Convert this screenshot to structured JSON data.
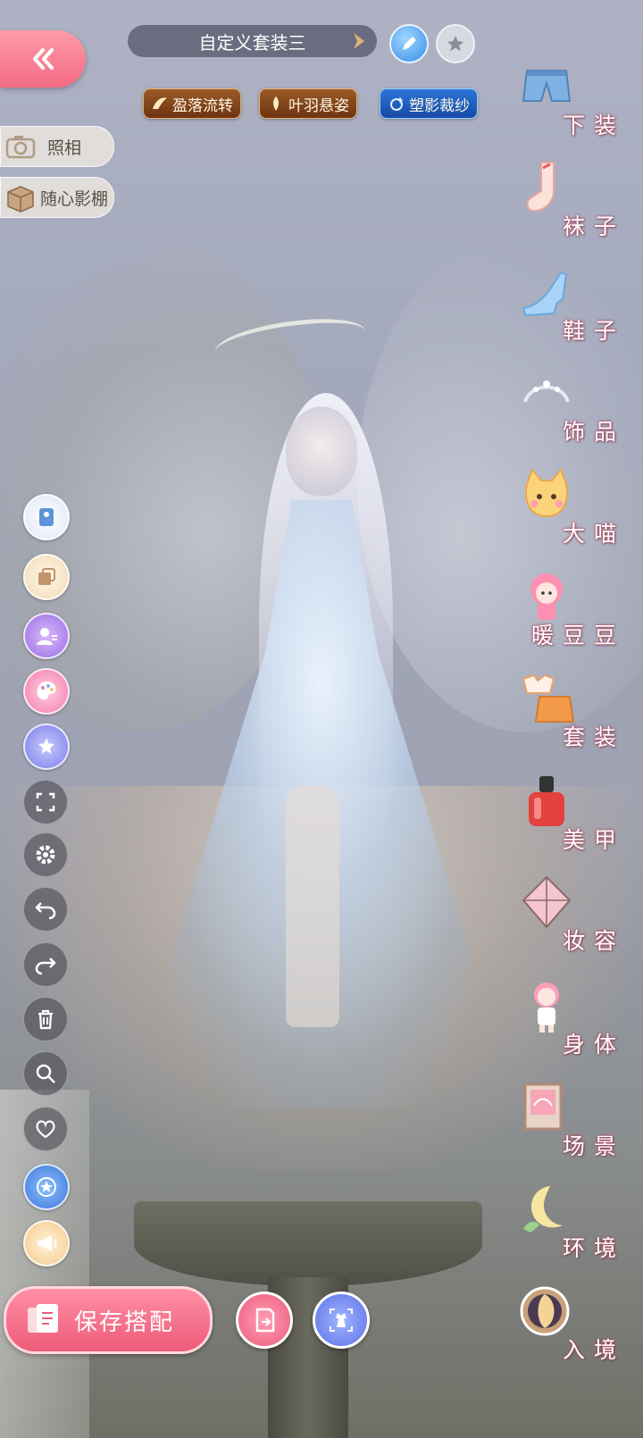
{
  "header": {
    "outfit_title": "自定义套装三",
    "tags": [
      {
        "label": "盈落流转",
        "style": "gold",
        "icon": "wing-icon"
      },
      {
        "label": "叶羽悬姿",
        "style": "gold",
        "icon": "leaf-icon"
      },
      {
        "label": "塑影裁纱",
        "style": "blue",
        "icon": "sparkle-icon"
      }
    ]
  },
  "side_menu": {
    "photo_label": "照相",
    "studio_label": "随心影棚"
  },
  "categories": [
    {
      "label": "下装",
      "icon": "shorts-icon"
    },
    {
      "label": "袜子",
      "icon": "sock-icon"
    },
    {
      "label": "鞋子",
      "icon": "shoe-icon"
    },
    {
      "label": "饰品",
      "icon": "tiara-icon"
    },
    {
      "label": "大喵",
      "icon": "cat-icon"
    },
    {
      "label": "暖豆豆",
      "icon": "doll-icon"
    },
    {
      "label": "套装",
      "icon": "outfit-icon"
    },
    {
      "label": "美甲",
      "icon": "nail-polish-icon"
    },
    {
      "label": "妆容",
      "icon": "makeup-icon"
    },
    {
      "label": "身体",
      "icon": "body-icon"
    },
    {
      "label": "场景",
      "icon": "scene-icon"
    },
    {
      "label": "环境",
      "icon": "moon-icon"
    },
    {
      "label": "入境",
      "icon": "portal-icon"
    }
  ],
  "footer": {
    "save_label": "保存搭配"
  },
  "colors": {
    "accent_pink": "#ee5b79",
    "tag_gold": "#6e3413",
    "tag_blue": "#174aa6"
  }
}
